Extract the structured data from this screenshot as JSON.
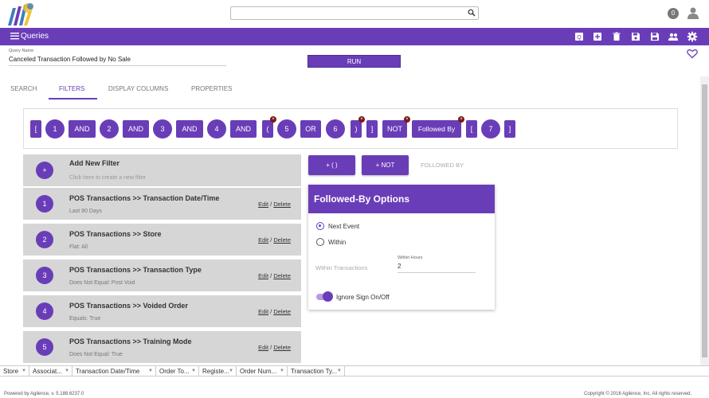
{
  "header": {
    "search_placeholder": "",
    "notification_count": "0"
  },
  "navbar": {
    "title": "Queries",
    "toolbar_icons": [
      "query-badge-icon",
      "add-icon",
      "delete-icon",
      "save-icon",
      "save-as-icon",
      "share-users-icon",
      "settings-icon"
    ]
  },
  "query": {
    "name_label": "Query Name",
    "name_value": "Canceled Transaction Followed by No Sale",
    "run_label": "RUN"
  },
  "tabs": [
    {
      "label": "SEARCH"
    },
    {
      "label": "FILTERS"
    },
    {
      "label": "DISPLAY COLUMNS"
    },
    {
      "label": "PROPERTIES"
    }
  ],
  "expression": {
    "tokens": [
      "[",
      "1",
      "AND",
      "2",
      "AND",
      "3",
      "AND",
      "4",
      "AND",
      "(",
      "5",
      "OR",
      "6",
      ")",
      "]",
      "NOT",
      "Followed By",
      "[",
      "7",
      "]"
    ]
  },
  "filters": {
    "add_new": {
      "title": "Add New Filter",
      "subtitle": "Click here to create a new filter",
      "icon": "+"
    },
    "items": [
      {
        "num": "1",
        "title": "POS Transactions >> Transaction Date/Time",
        "sub": "Last 90 Days"
      },
      {
        "num": "2",
        "title": "POS Transactions >> Store",
        "sub": "Flat: All"
      },
      {
        "num": "3",
        "title": "POS Transactions >> Transaction Type",
        "sub": "Does Not Equal: Post Void"
      },
      {
        "num": "4",
        "title": "POS Transactions >> Voided Order",
        "sub": "Equals: True"
      },
      {
        "num": "5",
        "title": "POS Transactions >> Training Mode",
        "sub": "Does Not Equal: True"
      }
    ],
    "edit_label": "Edit",
    "delete_label": "Delete",
    "separator": " / "
  },
  "operators": {
    "parens_label": "+ ( )",
    "not_label": "+ NOT",
    "followed_label": "FOLLOWED BY"
  },
  "followed_by": {
    "title": "Followed-By Options",
    "next_event_label": "Next Event",
    "within_label": "Within",
    "within_transactions_label": "Within Transactions",
    "within_hours_label": "Within Hours",
    "within_hours_value": "2",
    "ignore_sign_label": "Ignore Sign On/Off",
    "selected": "Next Event",
    "ignore_sign_on": true
  },
  "columns": [
    "Store",
    "Associat...",
    "Transaction Date/Time",
    "Order To...",
    "Registe...",
    "Order Num...",
    "Transaction Ty..."
  ],
  "footer": {
    "left": "Powered by Agilence, v. 5.188.6237.0",
    "right": "Copyright © 2016 Agilence, Inc. All rights reserved."
  },
  "colors": {
    "accent": "#6a3db8",
    "delete_marker": "#7a1818",
    "row_bg": "#d6d6d6"
  }
}
